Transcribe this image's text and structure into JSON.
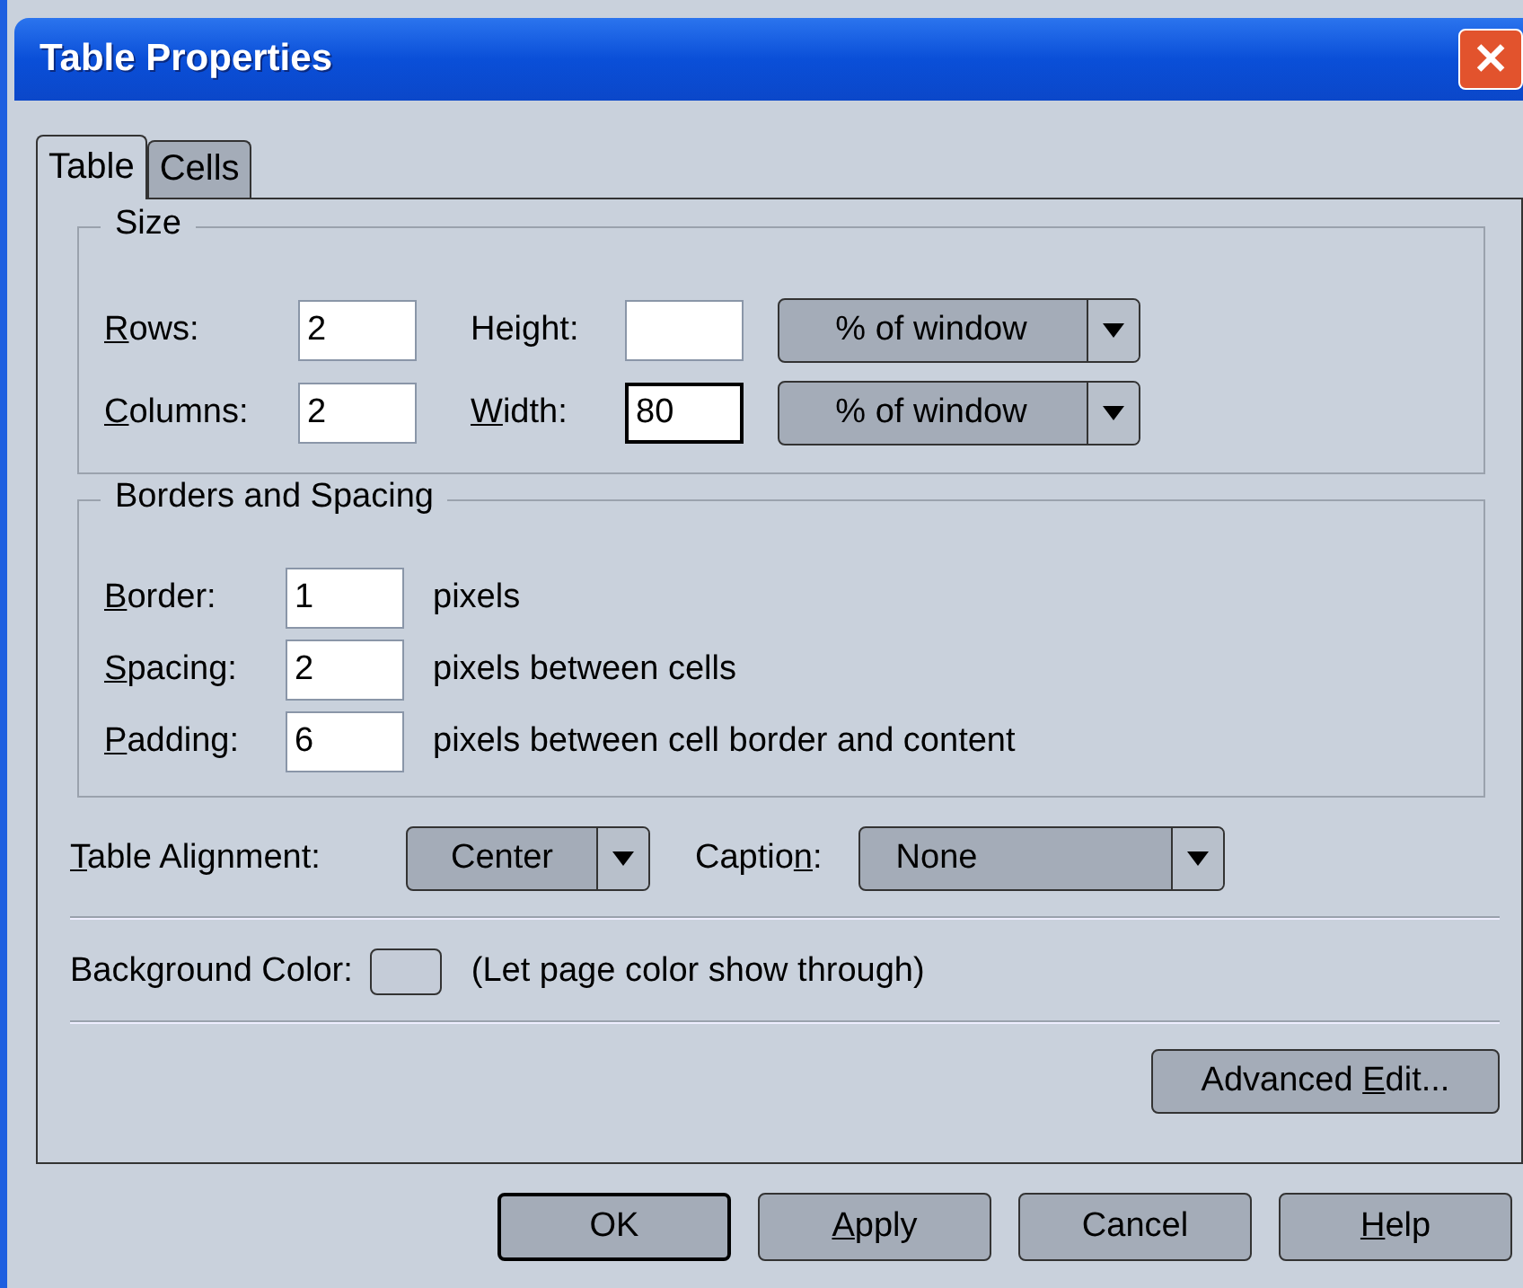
{
  "window": {
    "title": "Table Properties",
    "close": "✕"
  },
  "tabs": [
    {
      "label": "Table",
      "selected": true
    },
    {
      "label": "Cells",
      "selected": false
    }
  ],
  "size": {
    "title": "Size",
    "rows": [
      {
        "label": {
          "key": "R",
          "post": "ows:"
        },
        "value": "2",
        "focused": false,
        "label2": {
          "pre": "Hei",
          "key": "g",
          "post": "ht:"
        },
        "focused2": false,
        "unit": "% of window"
      },
      {
        "label": {
          "key": "C",
          "post": "olumns:"
        },
        "value": "2",
        "focused": false,
        "label2": {
          "key": "W",
          "post": "idth:"
        },
        "value2": "80",
        "focused2": true,
        "unit": "% of window"
      }
    ]
  },
  "borders": {
    "title": "Borders and Spacing",
    "rows": [
      {
        "label": {
          "key": "B",
          "post": "order:"
        },
        "value": "1",
        "focused": false,
        "note": "pixels"
      },
      {
        "label": {
          "key": "S",
          "post": "pacing:"
        },
        "value": "2",
        "focused": false,
        "note": "pixels between cells"
      },
      {
        "label": {
          "key": "P",
          "post": "adding:"
        },
        "value": "6",
        "focused": false,
        "note": "pixels between cell border and content"
      }
    ]
  },
  "alignment": {
    "label": {
      "key": "T",
      "post": "able Alignment:"
    },
    "value": "Center"
  },
  "caption": {
    "label": {
      "pre": "Captio",
      "key": "n",
      "post": ":"
    },
    "value": "None"
  },
  "background": {
    "label": "Background Color:",
    "color": "#c5ccd8",
    "note": "(Let page color show through)"
  },
  "advanced": {
    "pre": "Advanced ",
    "key": "E",
    "post": "dit..."
  },
  "buttons": [
    {
      "pre": "OK",
      "default": true
    },
    {
      "key": "A",
      "post": "pply",
      "default": false
    },
    {
      "pre": "Cancel",
      "default": false
    },
    {
      "key": "H",
      "post": "elp",
      "default": false
    }
  ]
}
